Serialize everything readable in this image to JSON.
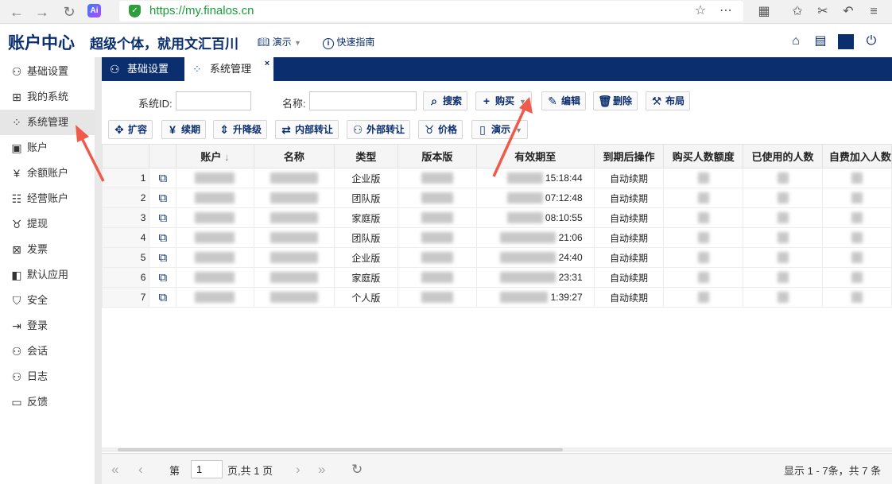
{
  "browser": {
    "url": "https://my.finalos.cn",
    "ai_badge": "Ai"
  },
  "header": {
    "title": "账户中心",
    "slogan": "超级个体，就用文汇百川",
    "demo_label": "演示",
    "guide_label": "快速指南"
  },
  "sidebar": {
    "items": [
      {
        "label": "基础设置",
        "icon": "user-icon"
      },
      {
        "label": "我的系统",
        "icon": "grid-icon"
      },
      {
        "label": "系统管理",
        "icon": "dots-icon"
      },
      {
        "label": "账户",
        "icon": "wallet-icon"
      },
      {
        "label": "余额账户",
        "icon": "yen-icon"
      },
      {
        "label": "经营账户",
        "icon": "chart-icon"
      },
      {
        "label": "提现",
        "icon": "bag-icon"
      },
      {
        "label": "发票",
        "icon": "invoice-icon"
      },
      {
        "label": "默认应用",
        "icon": "app-icon"
      },
      {
        "label": "安全",
        "icon": "shield-icon"
      },
      {
        "label": "登录",
        "icon": "login-icon"
      },
      {
        "label": "会话",
        "icon": "users-icon"
      },
      {
        "label": "日志",
        "icon": "log-icon"
      },
      {
        "label": "反馈",
        "icon": "chat-icon"
      }
    ]
  },
  "tabs": [
    {
      "label": "基础设置"
    },
    {
      "label": "系统管理"
    }
  ],
  "filters": {
    "sysid_label": "系统ID:",
    "name_label": "名称:"
  },
  "toolbar": {
    "search": "搜索",
    "buy": "购买",
    "edit": "编辑",
    "delete": "删除",
    "layout": "布局",
    "expand": "扩容",
    "renew": "续期",
    "upgrade": "升降级",
    "internal": "内部转让",
    "external": "外部转让",
    "price": "价格",
    "demo": "演示"
  },
  "table": {
    "columns": [
      "账户",
      "名称",
      "类型",
      "版本版",
      "有效期至",
      "到期后操作",
      "购买人数额度",
      "已使用的人数",
      "自费加入人数"
    ],
    "rows": [
      {
        "n": "1",
        "type": "企业版",
        "time": "15:18:44",
        "action": "自动续期"
      },
      {
        "n": "2",
        "type": "团队版",
        "time": "07:12:48",
        "action": "自动续期"
      },
      {
        "n": "3",
        "type": "家庭版",
        "time": "08:10:55",
        "action": "自动续期"
      },
      {
        "n": "4",
        "type": "团队版",
        "time": "21:06",
        "action": "自动续期"
      },
      {
        "n": "5",
        "type": "企业版",
        "time": "24:40",
        "action": "自动续期"
      },
      {
        "n": "6",
        "type": "家庭版",
        "time": "23:31",
        "action": "自动续期"
      },
      {
        "n": "7",
        "type": "个人版",
        "time": "1:39:27",
        "action": "自动续期"
      }
    ]
  },
  "pager": {
    "page_prefix": "第",
    "page": "1",
    "page_suffix": "页,共 1 页",
    "summary": "显示 1 - 7条，共 7 条"
  }
}
